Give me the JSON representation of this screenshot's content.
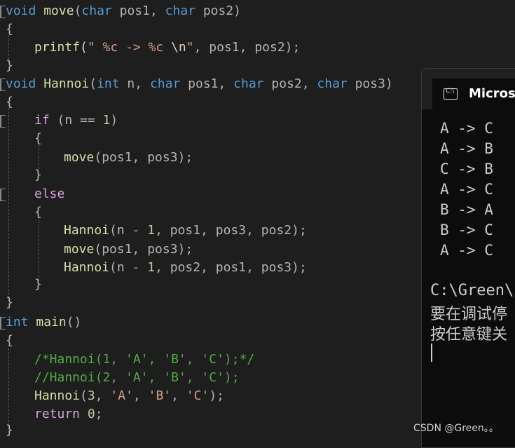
{
  "code": {
    "l1": [
      "void",
      " ",
      "move",
      "(",
      "char",
      " pos1, ",
      "char",
      " pos2)"
    ],
    "l2": "{",
    "l3": [
      "printf",
      "(",
      "\" %c -> %c ",
      "\\n",
      "\"",
      ", pos1, pos2);"
    ],
    "l4": "}",
    "l5": [
      "void",
      " ",
      "Hannoi",
      "(",
      "int",
      " n, ",
      "char",
      " pos1, ",
      "char",
      " pos2, ",
      "char",
      " pos3)"
    ],
    "l6": "{",
    "l7": [
      "if",
      " (n == ",
      "1",
      ")"
    ],
    "l8": "{",
    "l9": [
      "move",
      "(pos1, pos3);"
    ],
    "l10": "}",
    "l11": [
      "else"
    ],
    "l12": "{",
    "l13": [
      "Hannoi",
      "(n - ",
      "1",
      ", pos1, pos3, pos2);"
    ],
    "l14": [
      "move",
      "(pos1, pos3);"
    ],
    "l15": [
      "Hannoi",
      "(n - ",
      "1",
      ", pos2, pos1, pos3);"
    ],
    "l16": "}",
    "l17": "}",
    "l18": [
      "int",
      " ",
      "main",
      "()"
    ],
    "l19": "{",
    "l20": "/*Hannoi(1, 'A', 'B', 'C');*/",
    "l21": "//Hannoi(2, 'A', 'B', 'C');",
    "l22": [
      "Hannoi",
      "(",
      "3",
      ", ",
      "'A'",
      ", ",
      "'B'",
      ", ",
      "'C'",
      ");"
    ],
    "l23": [
      "return",
      " ",
      "0",
      ";"
    ],
    "l24": "}"
  },
  "console": {
    "title": "Microso",
    "icon": "terminal-icon",
    "output": [
      "A -> C",
      "A -> B",
      "C -> B",
      "A -> C",
      "B -> A",
      "B -> C",
      "A -> C"
    ],
    "path": "C:\\Green\\",
    "msg1": "要在调试停",
    "msg2": "按任意键关"
  },
  "watermark": "CSDN @Green。。"
}
